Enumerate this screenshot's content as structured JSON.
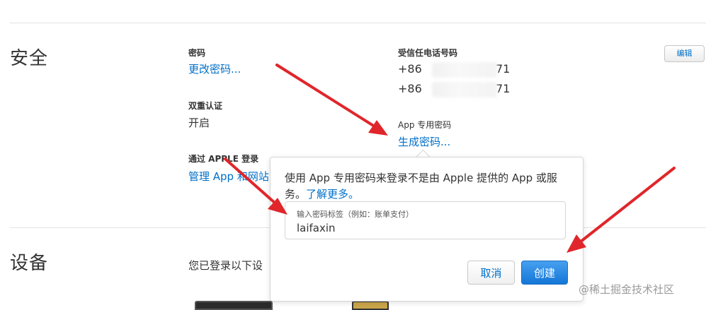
{
  "security": {
    "heading": "安全",
    "password": {
      "label": "密码",
      "link": "更改密码..."
    },
    "two_factor": {
      "label": "双重认证",
      "value": "开启"
    },
    "apple_signin": {
      "label": "通过 APPLE 登录",
      "link": "管理 App 和网站"
    },
    "trusted_phone": {
      "label": "受信任电话号码",
      "numbers": [
        "+86",
        "+86"
      ],
      "number_suffixes": [
        "71",
        "71"
      ]
    },
    "app_password": {
      "label": "App 专用密码",
      "link": "生成密码..."
    },
    "edit_label": "编辑"
  },
  "popover": {
    "description": "使用 App 专用密码来登录不是由 Apple 提供的 App 或服务。",
    "learn_more": "了解更多。",
    "input_placeholder": "输入密码标签（例如：账单支付）",
    "input_value": "laifaxin",
    "cancel_label": "取消",
    "create_label": "创建"
  },
  "devices": {
    "heading": "设备",
    "intro": "您已登录以下设"
  },
  "watermark": "@稀土掘金技术社区",
  "colors": {
    "link": "#0070c9",
    "annotation_arrow": "#e0262b",
    "primary_button": "#1476d6"
  }
}
